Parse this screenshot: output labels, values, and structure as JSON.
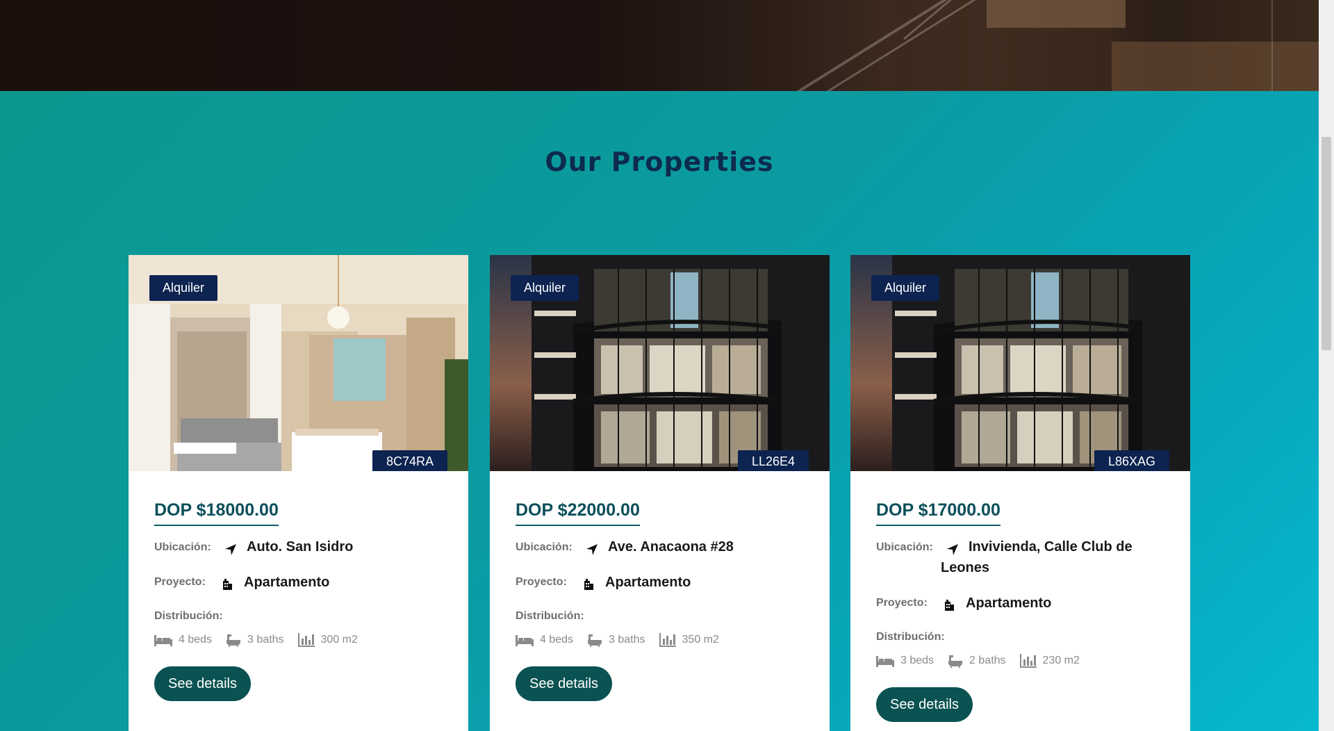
{
  "section": {
    "title": "Our Properties"
  },
  "properties": [
    {
      "badge": "Alquiler",
      "code": "8C74RA",
      "price": "DOP $18000.00",
      "location_label": "Ubicación:",
      "location": "Auto. San Isidro",
      "project_label": "Proyecto:",
      "project": "Apartamento",
      "distribution_label": "Distribución:",
      "beds": "4 beds",
      "baths": "3 baths",
      "area": "300 m2",
      "button": "See details"
    },
    {
      "badge": "Alquiler",
      "code": "LL26E4",
      "price": "DOP $22000.00",
      "location_label": "Ubicación:",
      "location": "Ave. Anacaona #28",
      "project_label": "Proyecto:",
      "project": "Apartamento",
      "distribution_label": "Distribución:",
      "beds": "4 beds",
      "baths": "3 baths",
      "area": "350 m2",
      "button": "See details"
    },
    {
      "badge": "Alquiler",
      "code": "L86XAG",
      "price": "DOP $17000.00",
      "location_label": "Ubicación:",
      "location": "Invivienda, Calle Club de Leones",
      "project_label": "Proyecto:",
      "project": "Apartamento",
      "distribution_label": "Distribución:",
      "beds": "3 beds",
      "baths": "2 baths",
      "area": "230 m2",
      "button": "See details"
    }
  ],
  "icons": {
    "location": "location-arrow-icon",
    "project": "building-icon",
    "beds": "bed-icon",
    "baths": "bathtub-icon",
    "area": "bar-chart-icon"
  },
  "colors": {
    "section_bg": "#0b9aa0",
    "badge_bg": "#0d2350",
    "price": "#0b4f5a",
    "button_bg": "#0b5252",
    "title": "#0d2b4e"
  }
}
